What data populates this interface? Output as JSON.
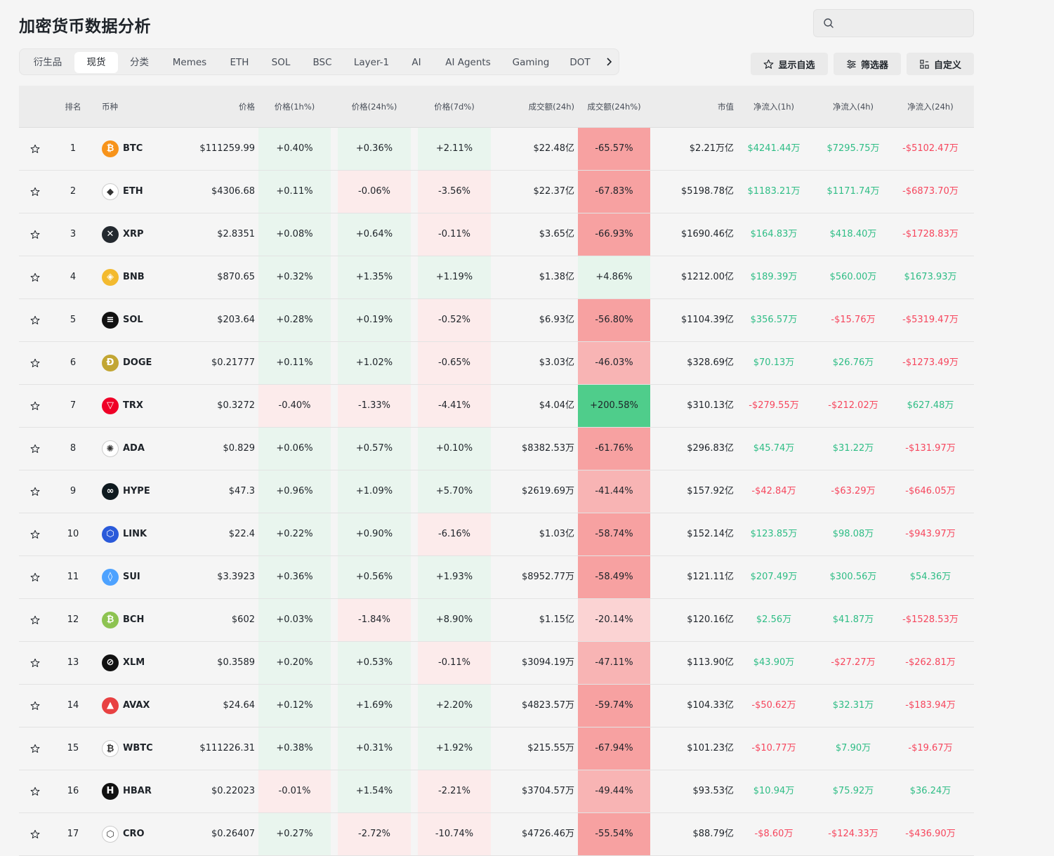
{
  "page": {
    "title": "加密货币数据分析"
  },
  "search": {
    "placeholder": ""
  },
  "tabs": [
    {
      "label": "衍生品",
      "active": false
    },
    {
      "label": "现货",
      "active": true
    },
    {
      "label": "分类",
      "active": false
    },
    {
      "label": "Memes",
      "active": false
    },
    {
      "label": "ETH",
      "active": false
    },
    {
      "label": "SOL",
      "active": false
    },
    {
      "label": "BSC",
      "active": false
    },
    {
      "label": "Layer-1",
      "active": false
    },
    {
      "label": "AI",
      "active": false
    },
    {
      "label": "AI Agents",
      "active": false
    },
    {
      "label": "Gaming",
      "active": false
    },
    {
      "label": "DOT",
      "active": false
    }
  ],
  "toolbar": {
    "watchlist_label": "显示自选",
    "filter_label": "筛选器",
    "customize_label": "自定义"
  },
  "columns": {
    "rank": "排名",
    "coin": "币种",
    "price": "价格",
    "ch1h": "价格(1h%)",
    "ch24h": "价格(24h%)",
    "ch7d": "价格(7d%)",
    "vol": "成交额(24h)",
    "volch": "成交额(24h%)",
    "mcap": "市值",
    "in1h": "净流入(1h)",
    "in4h": "净流入(4h)",
    "in24h": "净流入(24h)"
  },
  "colors": {
    "up_text": "#2ebd85",
    "down_text": "#f6465d",
    "up_light": "#e9f5ee",
    "up_mid": "#ddf1e6",
    "down_light": "#fcebeb",
    "vol_strong_red": "#f7a1a1",
    "vol_mid_red": "#f8b4b4",
    "vol_light_red": "#fbd3d3",
    "vol_green_light": "#e6f5ec",
    "vol_green_strong": "#4fcd8b"
  },
  "rows": [
    {
      "rank": "1",
      "symbol": "BTC",
      "price": "$111259.99",
      "ch1h": "+0.40%",
      "ch24h": "+0.36%",
      "ch7d": "+2.11%",
      "vol": "$22.48亿",
      "volch": "-65.57%",
      "mcap": "$2.21万亿",
      "in1h": "$4241.44万",
      "in4h": "$7295.75万",
      "in24h": "-$5102.47万",
      "icon": "bitcoin-icon",
      "icon_color": "#f7931a",
      "icon_text": "₿"
    },
    {
      "rank": "2",
      "symbol": "ETH",
      "price": "$4306.68",
      "ch1h": "+0.11%",
      "ch24h": "-0.06%",
      "ch7d": "-3.56%",
      "vol": "$22.37亿",
      "volch": "-67.83%",
      "mcap": "$5198.78亿",
      "in1h": "$1183.21万",
      "in4h": "$1171.74万",
      "in24h": "-$6873.70万",
      "icon": "ethereum-icon",
      "icon_color": "#ffffff",
      "icon_text": "◆"
    },
    {
      "rank": "3",
      "symbol": "XRP",
      "price": "$2.8351",
      "ch1h": "+0.08%",
      "ch24h": "+0.64%",
      "ch7d": "-0.11%",
      "vol": "$3.65亿",
      "volch": "-66.93%",
      "mcap": "$1690.46亿",
      "in1h": "$164.83万",
      "in4h": "$418.40万",
      "in24h": "-$1728.83万",
      "icon": "xrp-icon",
      "icon_color": "#23292f",
      "icon_text": "✕"
    },
    {
      "rank": "4",
      "symbol": "BNB",
      "price": "$870.65",
      "ch1h": "+0.32%",
      "ch24h": "+1.35%",
      "ch7d": "+1.19%",
      "vol": "$1.38亿",
      "volch": "+4.86%",
      "mcap": "$1212.00亿",
      "in1h": "$189.39万",
      "in4h": "$560.00万",
      "in24h": "$1673.93万",
      "icon": "bnb-icon",
      "icon_color": "#f3ba2f",
      "icon_text": "◈"
    },
    {
      "rank": "5",
      "symbol": "SOL",
      "price": "$203.64",
      "ch1h": "+0.28%",
      "ch24h": "+0.19%",
      "ch7d": "-0.52%",
      "vol": "$6.93亿",
      "volch": "-56.80%",
      "mcap": "$1104.39亿",
      "in1h": "$356.57万",
      "in4h": "-$15.76万",
      "in24h": "-$5319.47万",
      "icon": "solana-icon",
      "icon_color": "#111111",
      "icon_text": "≡"
    },
    {
      "rank": "6",
      "symbol": "DOGE",
      "price": "$0.21777",
      "ch1h": "+0.11%",
      "ch24h": "+1.02%",
      "ch7d": "-0.65%",
      "vol": "$3.03亿",
      "volch": "-46.03%",
      "mcap": "$328.69亿",
      "in1h": "$70.13万",
      "in4h": "$26.76万",
      "in24h": "-$1273.49万",
      "icon": "dogecoin-icon",
      "icon_color": "#c2a633",
      "icon_text": "Ð"
    },
    {
      "rank": "7",
      "symbol": "TRX",
      "price": "$0.3272",
      "ch1h": "-0.40%",
      "ch24h": "-1.33%",
      "ch7d": "-4.41%",
      "vol": "$4.04亿",
      "volch": "+200.58%",
      "mcap": "$310.13亿",
      "in1h": "-$279.55万",
      "in4h": "-$212.02万",
      "in24h": "$627.48万",
      "icon": "tron-icon",
      "icon_color": "#ef0027",
      "icon_text": "▽"
    },
    {
      "rank": "8",
      "symbol": "ADA",
      "price": "$0.829",
      "ch1h": "+0.06%",
      "ch24h": "+0.57%",
      "ch7d": "+0.10%",
      "vol": "$8382.53万",
      "volch": "-61.76%",
      "mcap": "$296.83亿",
      "in1h": "$45.74万",
      "in4h": "$31.22万",
      "in24h": "-$131.97万",
      "icon": "cardano-icon",
      "icon_color": "#ffffff",
      "icon_text": "✺"
    },
    {
      "rank": "9",
      "symbol": "HYPE",
      "price": "$47.3",
      "ch1h": "+0.96%",
      "ch24h": "+1.09%",
      "ch7d": "+5.70%",
      "vol": "$2619.69万",
      "volch": "-41.44%",
      "mcap": "$157.92亿",
      "in1h": "-$42.84万",
      "in4h": "-$63.29万",
      "in24h": "-$646.05万",
      "icon": "hyperliquid-icon",
      "icon_color": "#0f1a1f",
      "icon_text": "∞"
    },
    {
      "rank": "10",
      "symbol": "LINK",
      "price": "$22.4",
      "ch1h": "+0.22%",
      "ch24h": "+0.90%",
      "ch7d": "-6.16%",
      "vol": "$1.03亿",
      "volch": "-58.74%",
      "mcap": "$152.14亿",
      "in1h": "$123.85万",
      "in4h": "$98.08万",
      "in24h": "-$943.97万",
      "icon": "chainlink-icon",
      "icon_color": "#2a5ada",
      "icon_text": "⬡"
    },
    {
      "rank": "11",
      "symbol": "SUI",
      "price": "$3.3923",
      "ch1h": "+0.36%",
      "ch24h": "+0.56%",
      "ch7d": "+1.93%",
      "vol": "$8952.77万",
      "volch": "-58.49%",
      "mcap": "$121.11亿",
      "in1h": "$207.49万",
      "in4h": "$300.56万",
      "in24h": "$54.36万",
      "icon": "sui-icon",
      "icon_color": "#4da2ff",
      "icon_text": "◊"
    },
    {
      "rank": "12",
      "symbol": "BCH",
      "price": "$602",
      "ch1h": "+0.03%",
      "ch24h": "-1.84%",
      "ch7d": "+8.90%",
      "vol": "$1.15亿",
      "volch": "-20.14%",
      "mcap": "$120.16亿",
      "in1h": "$2.56万",
      "in4h": "$41.87万",
      "in24h": "-$1528.53万",
      "icon": "bitcoin-cash-icon",
      "icon_color": "#8dc351",
      "icon_text": "₿"
    },
    {
      "rank": "13",
      "symbol": "XLM",
      "price": "$0.3589",
      "ch1h": "+0.20%",
      "ch24h": "+0.53%",
      "ch7d": "-0.11%",
      "vol": "$3094.19万",
      "volch": "-47.11%",
      "mcap": "$113.90亿",
      "in1h": "$43.90万",
      "in4h": "-$27.27万",
      "in24h": "-$262.81万",
      "icon": "stellar-icon",
      "icon_color": "#111111",
      "icon_text": "⊘"
    },
    {
      "rank": "14",
      "symbol": "AVAX",
      "price": "$24.64",
      "ch1h": "+0.12%",
      "ch24h": "+1.69%",
      "ch7d": "+2.20%",
      "vol": "$4823.57万",
      "volch": "-59.74%",
      "mcap": "$104.33亿",
      "in1h": "-$50.62万",
      "in4h": "$32.31万",
      "in24h": "-$183.94万",
      "icon": "avalanche-icon",
      "icon_color": "#e84142",
      "icon_text": "▲"
    },
    {
      "rank": "15",
      "symbol": "WBTC",
      "price": "$111226.31",
      "ch1h": "+0.38%",
      "ch24h": "+0.31%",
      "ch7d": "+1.92%",
      "vol": "$215.55万",
      "volch": "-67.94%",
      "mcap": "$101.23亿",
      "in1h": "-$10.77万",
      "in4h": "$7.90万",
      "in24h": "-$19.67万",
      "icon": "wrapped-bitcoin-icon",
      "icon_color": "#ffffff",
      "icon_text": "₿"
    },
    {
      "rank": "16",
      "symbol": "HBAR",
      "price": "$0.22023",
      "ch1h": "-0.01%",
      "ch24h": "+1.54%",
      "ch7d": "-2.21%",
      "vol": "$3704.57万",
      "volch": "-49.44%",
      "mcap": "$93.53亿",
      "in1h": "$10.94万",
      "in4h": "$75.92万",
      "in24h": "$36.24万",
      "icon": "hedera-icon",
      "icon_color": "#111111",
      "icon_text": "H"
    },
    {
      "rank": "17",
      "symbol": "CRO",
      "price": "$0.26407",
      "ch1h": "+0.27%",
      "ch24h": "-2.72%",
      "ch7d": "-10.74%",
      "vol": "$4726.46万",
      "volch": "-55.54%",
      "mcap": "$88.79亿",
      "in1h": "-$8.60万",
      "in4h": "-$124.33万",
      "in24h": "-$436.90万",
      "icon": "cronos-icon",
      "icon_color": "#ffffff",
      "icon_text": "⬡"
    }
  ]
}
